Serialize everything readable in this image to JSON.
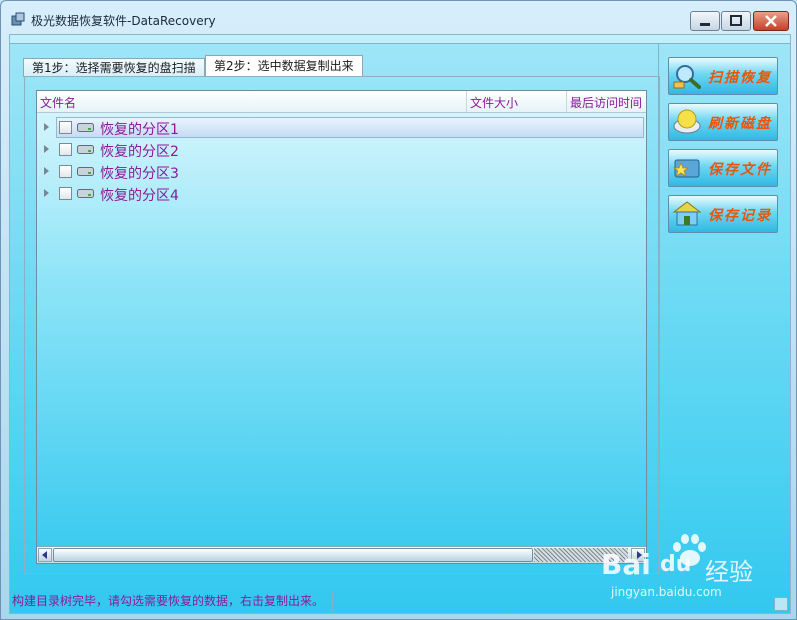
{
  "window": {
    "title": "极光数据恢复软件-DataRecovery",
    "controls": [
      "minimize",
      "maximize",
      "close"
    ]
  },
  "tabs": [
    {
      "label": "第1步：选择需要恢复的盘扫描",
      "selected": false
    },
    {
      "label": "第2步：选中数据复制出来",
      "selected": true
    }
  ],
  "file_list": {
    "columns": [
      "文件名",
      "文件大小",
      "最后访问时间"
    ],
    "rows": [
      {
        "label": "恢复的分区1",
        "selected": true,
        "checked": false
      },
      {
        "label": "恢复的分区2",
        "selected": false,
        "checked": false
      },
      {
        "label": "恢复的分区3",
        "selected": false,
        "checked": false
      },
      {
        "label": "恢复的分区4",
        "selected": false,
        "checked": false
      }
    ]
  },
  "actions": [
    {
      "label": "扫描恢复",
      "icon": "magnifier-icon"
    },
    {
      "label": "刷新磁盘",
      "icon": "disk-refresh-icon"
    },
    {
      "label": "保存文件",
      "icon": "save-file-icon"
    },
    {
      "label": "保存记录",
      "icon": "house-record-icon"
    }
  ],
  "status": {
    "message": "构建目录树完毕，请勾选需要恢复的数据，右击复制出来。"
  },
  "watermark": {
    "brand_bai": "Bai",
    "brand_du": "du",
    "brand_cn": "经验",
    "url": "jingyan.baidu.com"
  },
  "colors": {
    "accent_text": "#8b1a9a",
    "button_text": "#e8560a",
    "client_bg": "#33c8ef"
  }
}
